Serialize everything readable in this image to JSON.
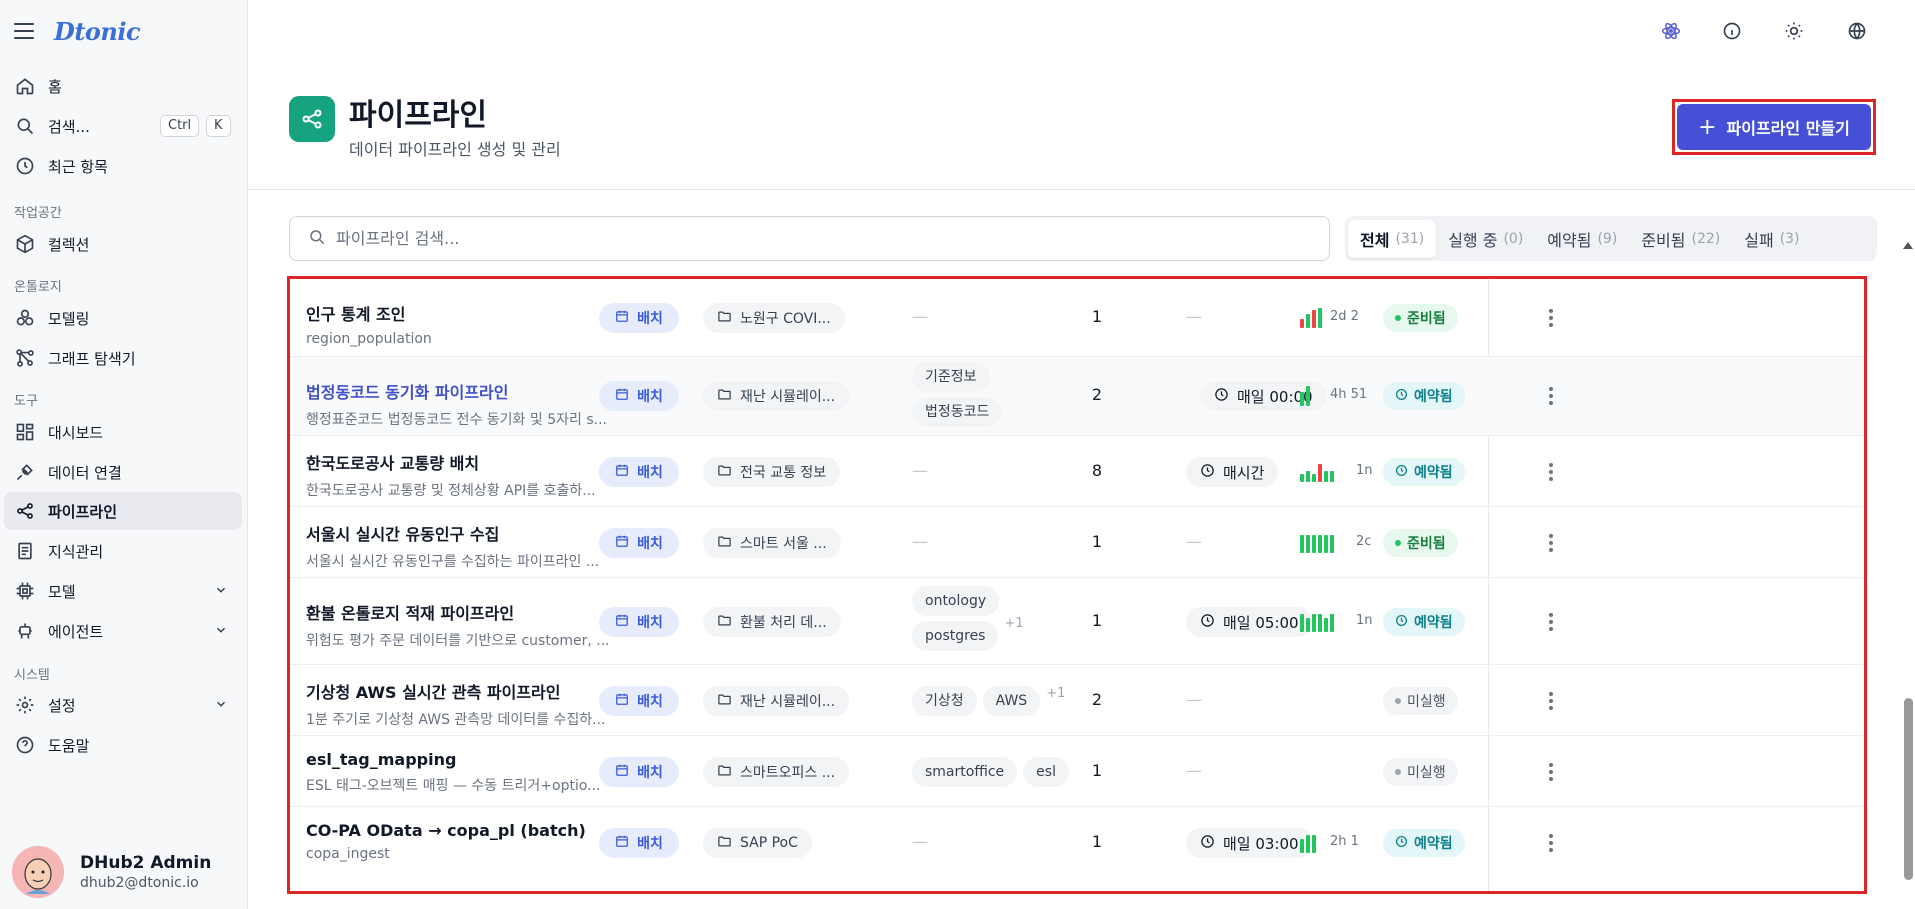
{
  "app": {
    "logo": "Dtonic"
  },
  "sidebar": {
    "home": "홈",
    "search": "검색...",
    "search_kbd_ctrl": "Ctrl",
    "search_kbd_k": "K",
    "recent": "최근 항목",
    "section_workspace": "작업공간",
    "collection": "컬렉션",
    "section_ontology": "온톨로지",
    "modeling": "모델링",
    "graph_explorer": "그래프 탐색기",
    "section_tools": "도구",
    "dashboard": "대시보드",
    "data_connection": "데이터 연결",
    "pipeline": "파이프라인",
    "knowledge": "지식관리",
    "model": "모델",
    "agent": "에이전트",
    "section_system": "시스템",
    "settings": "설정",
    "help": "도움말"
  },
  "user": {
    "name": "DHub2 Admin",
    "email": "dhub2@dtonic.io"
  },
  "header": {
    "title": "파이프라인",
    "subtitle": "데이터 파이프라인 생성 및 관리",
    "create_button": "파이프라인 만들기"
  },
  "search": {
    "placeholder": "파이프라인 검색..."
  },
  "tabs": [
    {
      "label": "전체",
      "count": "(31)"
    },
    {
      "label": "실행 중",
      "count": "(0)"
    },
    {
      "label": "예약됨",
      "count": "(9)"
    },
    {
      "label": "준비됨",
      "count": "(22)"
    },
    {
      "label": "실패",
      "count": "(3)"
    }
  ],
  "rows": [
    {
      "title": "인구 통계 조인",
      "desc": "region_population",
      "type": "배치",
      "folder": "노원구 COVI...",
      "tags": [],
      "tags_more": "",
      "count": "1",
      "schedule": "",
      "duration": "2d 2",
      "status": "준비됨"
    },
    {
      "title": "법정동코드 동기화 파이프라인",
      "desc": "행정표준코드 법정동코드 전수 동기화 및 5자리 s...",
      "type": "배치",
      "folder": "재난 시뮬레이...",
      "tags": [
        "기준정보",
        "법정동코드"
      ],
      "tags_more": "",
      "count": "2",
      "schedule": "매일 00:00",
      "duration": "4h 51",
      "status": "예약됨"
    },
    {
      "title": "한국도로공사 교통량 배치",
      "desc": "한국도로공사 교통량 및 정체상황 API를 호출하...",
      "type": "배치",
      "folder": "전국 교통 정보",
      "tags": [],
      "tags_more": "",
      "count": "8",
      "schedule": "매시간",
      "duration": "1n",
      "status": "예약됨"
    },
    {
      "title": "서울시 실시간 유동인구 수집",
      "desc": "서울시 실시간 유동인구를 수집하는 파이프라인 ...",
      "type": "배치",
      "folder": "스마트 서울 ...",
      "tags": [],
      "tags_more": "",
      "count": "1",
      "schedule": "",
      "duration": "2c",
      "status": "준비됨"
    },
    {
      "title": "환불 온톨로지 적재 파이프라인",
      "desc": "위험도 평가 주문 데이터를 기반으로 customer, ...",
      "type": "배치",
      "folder": "환불 처리 데...",
      "tags": [
        "ontology",
        "postgres"
      ],
      "tags_more": "+1",
      "count": "1",
      "schedule": "매일 05:00",
      "duration": "1n",
      "status": "예약됨"
    },
    {
      "title": "기상청 AWS 실시간 관측 파이프라인",
      "desc": "1분 주기로 기상청 AWS 관측망 데이터를 수집하...",
      "type": "배치",
      "folder": "재난 시뮬레이...",
      "tags": [
        "기상청",
        "AWS"
      ],
      "tags_more": "+1",
      "count": "2",
      "schedule": "",
      "duration": "",
      "status": "미실행"
    },
    {
      "title": "esl_tag_mapping",
      "desc": "ESL 태그-오브젝트 매핑 — 수동 트리거+optio...",
      "type": "배치",
      "folder": "스마트오피스 ...",
      "tags": [
        "smartoffice",
        "esl"
      ],
      "tags_more": "",
      "count": "1",
      "schedule": "",
      "duration": "",
      "status": "미실행"
    },
    {
      "title": "CO-PA OData → copa_pl (batch)",
      "desc": "copa_ingest",
      "type": "배치",
      "folder": "SAP PoC",
      "tags": [],
      "tags_more": "",
      "count": "1",
      "schedule": "매일 03:00",
      "duration": "2h 1",
      "status": "예약됨"
    }
  ],
  "colors": {
    "accent": "#4550d6",
    "pipeline_badge": "#16a37f",
    "highlight_border": "#dc2626",
    "bar_success": "#22c55e",
    "bar_fail": "#ef4444"
  }
}
